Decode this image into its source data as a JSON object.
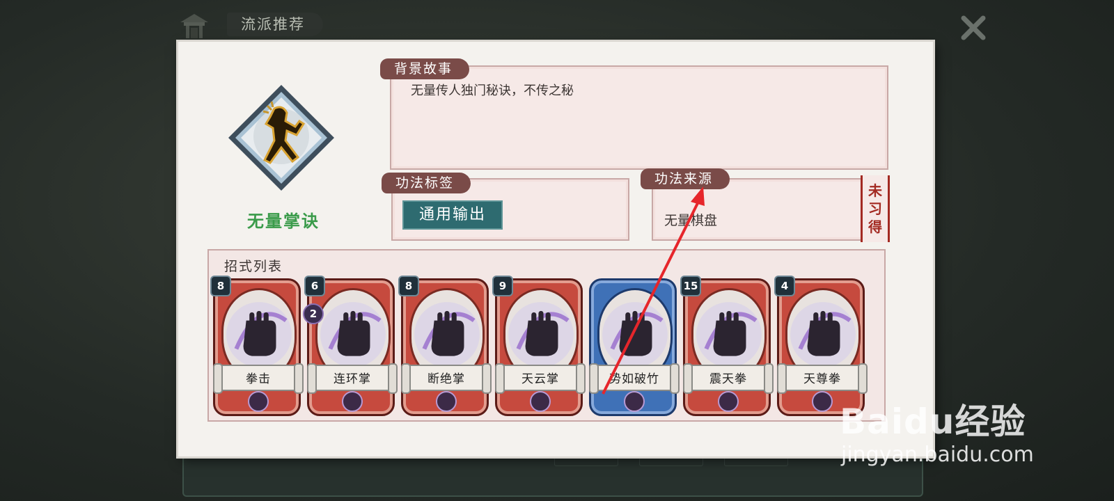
{
  "header": {
    "title": "流派推荐"
  },
  "skill": {
    "name": "无量掌诀"
  },
  "background": {
    "label": "背景故事",
    "text": "无量传人独门秘诀，不传之秘"
  },
  "tags": {
    "label": "功法标签",
    "value": "通用输出"
  },
  "source": {
    "label": "功法来源",
    "value": "无量棋盘",
    "status": [
      "未",
      "习",
      "得"
    ]
  },
  "moves": {
    "title": "招式列表",
    "cards": [
      {
        "name": "拳击",
        "cost": "8",
        "theme": "red"
      },
      {
        "name": "连环掌",
        "cost": "6",
        "subcost": "2",
        "theme": "red"
      },
      {
        "name": "断绝掌",
        "cost": "8",
        "theme": "red"
      },
      {
        "name": "天云掌",
        "cost": "9",
        "theme": "red"
      },
      {
        "name": "势如破竹",
        "theme": "blue"
      },
      {
        "name": "震天拳",
        "cost": "15",
        "theme": "red"
      },
      {
        "name": "天尊拳",
        "cost": "4",
        "theme": "red"
      }
    ]
  },
  "colors": {
    "red_card": "#c64a3e",
    "blue_card": "#3f71b7",
    "skill_name": "#3a9b4a",
    "tag_bg": "#2e6b70",
    "arrow": "#e6262b"
  },
  "watermark": {
    "logo": "Baidu经验",
    "url": "jingyan.baidu.com"
  }
}
